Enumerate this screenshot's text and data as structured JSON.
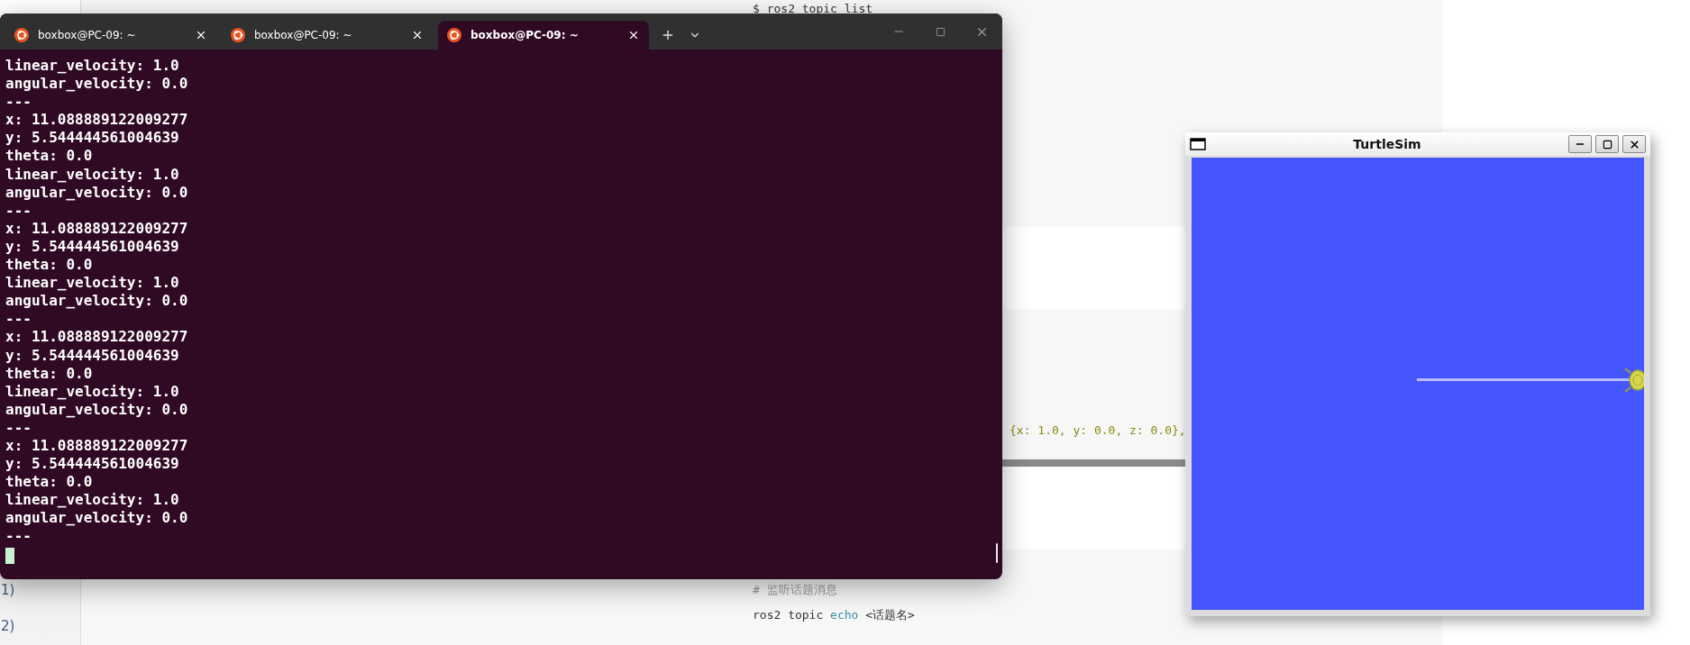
{
  "document": {
    "margin_items": [
      "1)",
      "2)"
    ],
    "top_command": "$ ros2 topic list",
    "cut_code": "{x: 1.0, y: 0.0, z: 0.0},",
    "comment": "# 监听话题消息",
    "echo_command": [
      {
        "text": "ros2 topic ",
        "kind": "plain"
      },
      {
        "text": "echo",
        "kind": "keyword"
      },
      {
        "text": " <话题名>",
        "kind": "plain"
      }
    ]
  },
  "terminal": {
    "tabs": [
      {
        "title": "boxbox@PC-09: ~",
        "selected": false
      },
      {
        "title": "boxbox@PC-09: ~",
        "selected": false
      },
      {
        "title": "boxbox@PC-09: ~",
        "selected": true
      }
    ],
    "lines": [
      "linear_velocity: 1.0",
      "angular_velocity: 0.0",
      "---",
      "x: 11.088889122009277",
      "y: 5.544444561004639",
      "theta: 0.0",
      "linear_velocity: 1.0",
      "angular_velocity: 0.0",
      "---",
      "x: 11.088889122009277",
      "y: 5.544444561004639",
      "theta: 0.0",
      "linear_velocity: 1.0",
      "angular_velocity: 0.0",
      "---",
      "x: 11.088889122009277",
      "y: 5.544444561004639",
      "theta: 0.0",
      "linear_velocity: 1.0",
      "angular_velocity: 0.0",
      "---",
      "x: 11.088889122009277",
      "y: 5.544444561004639",
      "theta: 0.0",
      "linear_velocity: 1.0",
      "angular_velocity: 0.0",
      "---"
    ]
  },
  "turtlesim": {
    "title": "TurtleSim"
  }
}
